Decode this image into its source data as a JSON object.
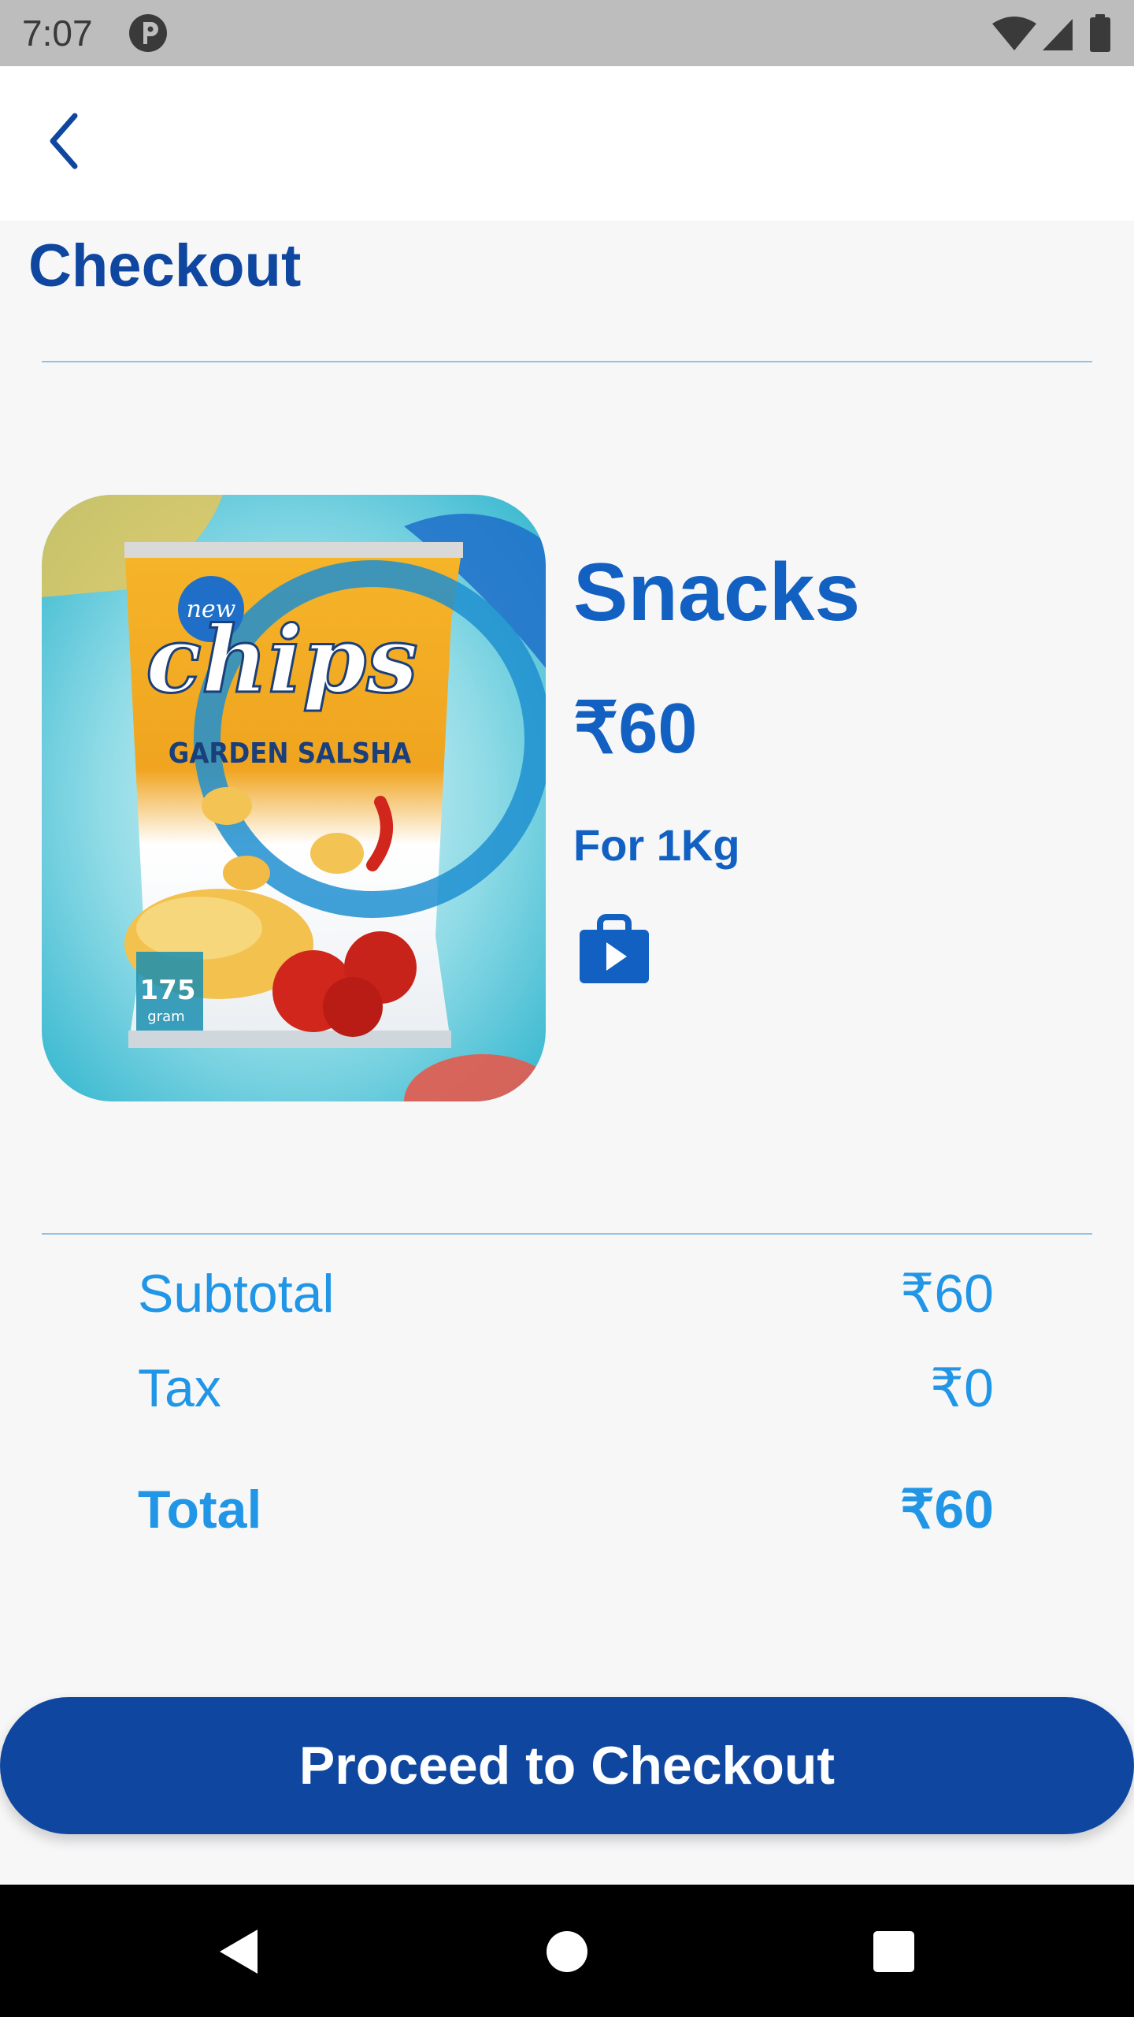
{
  "status_bar": {
    "time": "7:07"
  },
  "header": {
    "title": "Checkout"
  },
  "product": {
    "image_icon": "chips-packet-image",
    "image_text": {
      "brand": "chips",
      "badge": "new",
      "flavor": "GARDEN SALSHA",
      "weight_value": "175",
      "weight_unit": "gram"
    },
    "name": "Snacks",
    "price": "₹60",
    "unit": "For 1Kg",
    "store_icon": "shopping-bag-play-icon"
  },
  "summary": {
    "subtotal_label": "Subtotal",
    "subtotal_value": "₹60",
    "tax_label": "Tax",
    "tax_value": "₹0",
    "total_label": "Total",
    "total_value": "₹60"
  },
  "actions": {
    "checkout_label": "Proceed to Checkout"
  },
  "colors": {
    "primary_dark": "#0f47a0",
    "primary": "#1160c2",
    "accent": "#2196e6",
    "background": "#f7f7f8"
  }
}
